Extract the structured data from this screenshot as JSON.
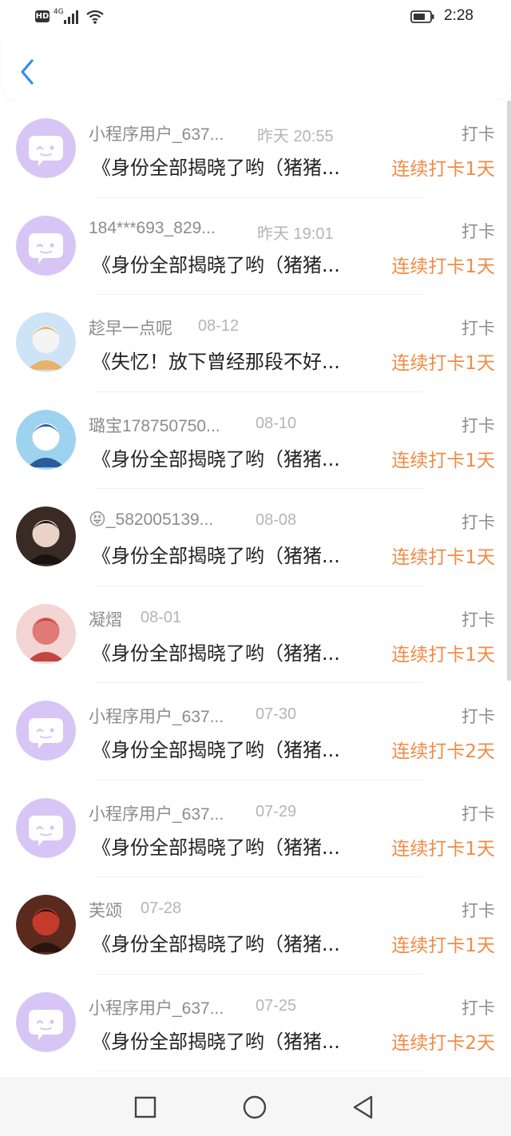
{
  "status_bar": {
    "hd_label": "HD",
    "network_label": "4G",
    "time": "2:28",
    "icons": [
      "hd-icon",
      "signal-icon",
      "wifi-icon",
      "battery-icon"
    ]
  },
  "header": {
    "back_icon": "chevron-left-icon",
    "accent_color": "#2f8ff0"
  },
  "colors": {
    "streak": "#f08b45",
    "username": "#8c8c8c",
    "timestamp": "#b5b5b5",
    "title": "#222222",
    "default_avatar": "#d7c6f5"
  },
  "entries": [
    {
      "username": "小程序用户_637...",
      "time": "昨天 20:55",
      "tag": "打卡",
      "title": "《身份全部揭晓了哟（猪猪...",
      "streak": "连续打卡1天",
      "avatar": "default-chat-avatar"
    },
    {
      "username": "184***693_829...",
      "time": "昨天 19:01",
      "tag": "打卡",
      "title": "《身份全部揭晓了哟（猪猪...",
      "streak": "连续打卡1天",
      "avatar": "default-chat-avatar"
    },
    {
      "username": "趁早一点呢",
      "time": "08-12",
      "tag": "打卡",
      "title": "《失忆！放下曾经那段不好...",
      "streak": "连续打卡1天",
      "avatar": "photo-avatar"
    },
    {
      "username": "璐宝178750750...",
      "time": "08-10",
      "tag": "打卡",
      "title": "《身份全部揭晓了哟（猪猪...",
      "streak": "连续打卡1天",
      "avatar": "photo-avatar"
    },
    {
      "username": "😝_582005139...",
      "time": "08-08",
      "tag": "打卡",
      "title": "《身份全部揭晓了哟（猪猪...",
      "streak": "连续打卡1天",
      "avatar": "photo-avatar"
    },
    {
      "username": "凝熠",
      "time": "08-01",
      "tag": "打卡",
      "title": "《身份全部揭晓了哟（猪猪...",
      "streak": "连续打卡1天",
      "avatar": "photo-avatar"
    },
    {
      "username": "小程序用户_637...",
      "time": "07-30",
      "tag": "打卡",
      "title": "《身份全部揭晓了哟（猪猪...",
      "streak": "连续打卡2天",
      "avatar": "default-chat-avatar"
    },
    {
      "username": "小程序用户_637...",
      "time": "07-29",
      "tag": "打卡",
      "title": "《身份全部揭晓了哟（猪猪...",
      "streak": "连续打卡1天",
      "avatar": "default-chat-avatar"
    },
    {
      "username": "芙颂",
      "time": "07-28",
      "tag": "打卡",
      "title": "《身份全部揭晓了哟（猪猪...",
      "streak": "连续打卡1天",
      "avatar": "photo-avatar"
    },
    {
      "username": "小程序用户_637...",
      "time": "07-25",
      "tag": "打卡",
      "title": "《身份全部揭晓了哟（猪猪...",
      "streak": "连续打卡2天",
      "avatar": "default-chat-avatar"
    }
  ],
  "nav_bar": {
    "icons": [
      "recent-apps-icon",
      "home-icon",
      "back-icon"
    ]
  }
}
